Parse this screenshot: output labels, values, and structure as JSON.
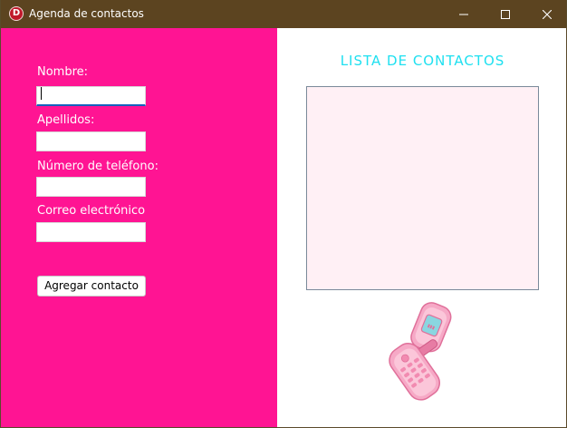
{
  "window": {
    "title": "Agenda de contactos",
    "icon": "app-d-icon",
    "icon_letter": "D",
    "controls": [
      "minimize-icon",
      "maximize-icon",
      "close-icon"
    ]
  },
  "form": {
    "background": "#ff1493",
    "nombre_label": "Nombre:",
    "nombre_value": "",
    "apellidos_label": "Apellidos:",
    "apellidos_value": "",
    "telefono_label": "Número de  teléfono:",
    "telefono_value": "",
    "correo_label": "Correo electrónico",
    "correo_value": "",
    "add_button_label": "Agregar contacto"
  },
  "contacts": {
    "title": "LISTA DE CONTACTOS",
    "title_color": "#1fe0f0",
    "list_background": "#fff0f5",
    "items": [],
    "image": "pink-flip-phone-icon"
  }
}
